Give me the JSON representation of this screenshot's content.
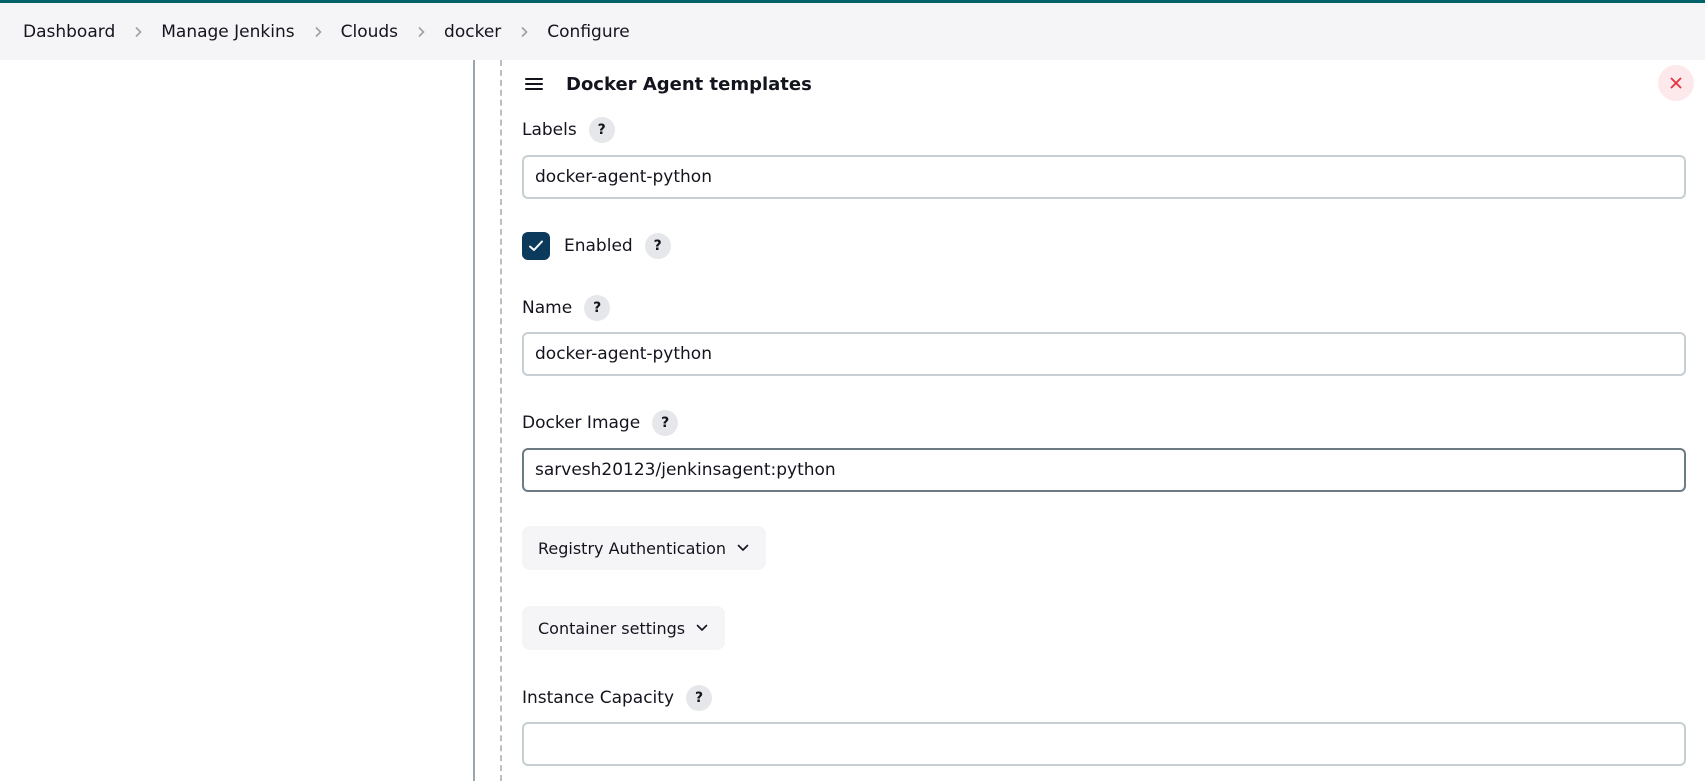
{
  "breadcrumb": {
    "items": [
      "Dashboard",
      "Manage Jenkins",
      "Clouds",
      "docker",
      "Configure"
    ]
  },
  "section": {
    "title": "Docker Agent templates"
  },
  "fields": {
    "labels": {
      "label": "Labels",
      "value": "docker-agent-python"
    },
    "enabled": {
      "label": "Enabled",
      "checked": true
    },
    "name": {
      "label": "Name",
      "value": "docker-agent-python"
    },
    "docker_image": {
      "label": "Docker Image",
      "value": "sarvesh20123/jenkinsagent:python"
    },
    "instance_capacity": {
      "label": "Instance Capacity",
      "value": ""
    }
  },
  "dropdowns": {
    "registry_auth": "Registry Authentication",
    "container_settings": "Container settings"
  },
  "help_glyph": "?",
  "colors": {
    "accent": "#006269",
    "checkbox": "#0b3a5c",
    "delete_bg": "#fde9eb",
    "delete_icon": "#e6313c"
  }
}
